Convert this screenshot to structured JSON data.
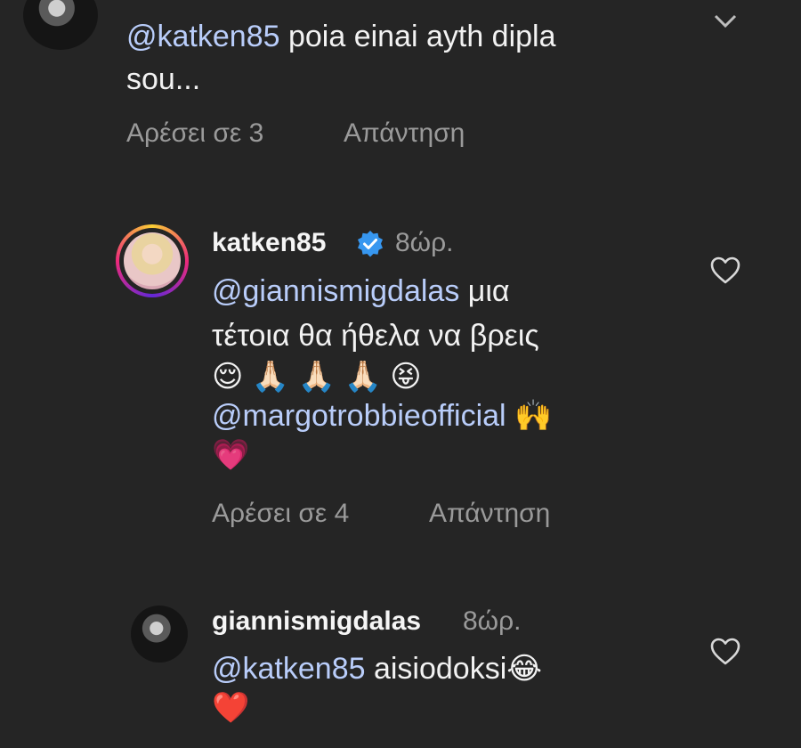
{
  "comment1": {
    "mention": "@katken85",
    "text_line1": " poia einai ayth dipla",
    "text_line2": "sou...",
    "likes": "Αρέσει σε 3",
    "reply": "Απάντηση"
  },
  "comment2": {
    "username": "katken85",
    "time": "8ώρ.",
    "mention1": "@giannismigdalas",
    "text1": " μια",
    "text2": "τέτοια θα ήθελα να βρεις",
    "emojis1": "😌 🙏🏻 🙏🏻 🙏🏻 😝",
    "mention2": "@margotrobbieofficial",
    "emoji2": " 🙌",
    "emoji3": "💗",
    "likes": "Αρέσει σε 4",
    "reply": "Απάντηση"
  },
  "comment3": {
    "username": "giannismigdalas",
    "time": "8ώρ.",
    "mention": "@katken85",
    "text": " aisiodoksi😂",
    "emoji": "❤️"
  },
  "icons": {
    "heart": "heart-icon",
    "verified": "verified-badge-icon",
    "chevron": "chevron-down-icon"
  },
  "colors": {
    "background": "#252525",
    "mention": "#b9cdfa",
    "meta": "#9a9a9a",
    "verified": "#3797f0"
  }
}
